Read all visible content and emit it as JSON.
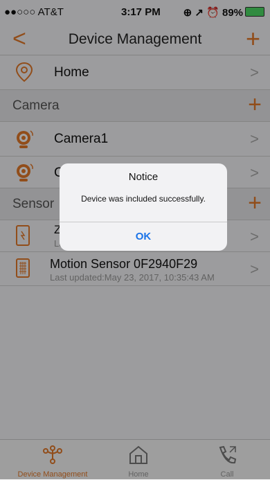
{
  "statusbar": {
    "carrier": "●●○○○ AT&T",
    "time": "3:17 PM",
    "right": "⊕ ↗ ⏰ 89%"
  },
  "navbar": {
    "back": "<",
    "title": "Device Management",
    "add": "+"
  },
  "rows": {
    "home": {
      "label": "Home",
      "chev": ">"
    },
    "camera1": {
      "label": "Camera1",
      "chev": ">"
    },
    "camera2": {
      "label": "C",
      "chev": ">"
    },
    "zwave": {
      "label": "Z-",
      "sub": "La",
      "chev": ">"
    },
    "motion": {
      "label": "Motion Sensor 0F2940F29",
      "sub": "Last updated:May 23, 2017, 10:35:43 AM",
      "chev": ">"
    }
  },
  "sections": {
    "camera": {
      "title": "Camera",
      "add": "+"
    },
    "sensor": {
      "title": "Sensor",
      "add": "+"
    }
  },
  "dialog": {
    "title": "Notice",
    "message": "Device was included successfully.",
    "ok": "OK"
  },
  "tabs": [
    {
      "label": "Device Management",
      "active": true
    },
    {
      "label": "Home",
      "active": false
    },
    {
      "label": "Call",
      "active": false
    }
  ],
  "colors": {
    "accent": "#e3792a",
    "link": "#1a73e8"
  }
}
